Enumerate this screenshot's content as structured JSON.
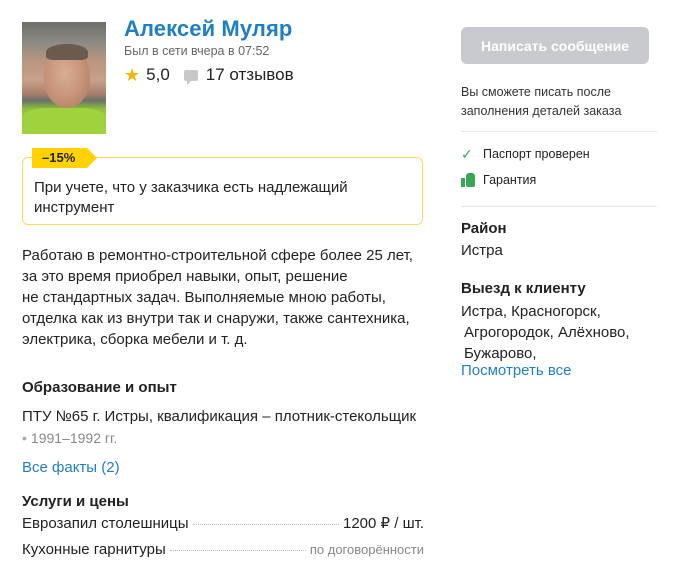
{
  "profile": {
    "name": "Алексей Муляр",
    "last_seen": "Был в сети вчера в 07:52",
    "rating": "5,0",
    "reviews": "17 отзывов"
  },
  "discount": {
    "tag": "–15%",
    "text": "При учете, что у заказчика есть надлежащий инструмент"
  },
  "about": {
    "lines": [
      "Работаю в ремонтно-строительной сфере более 25 лет,",
      "за это время приобрел навыки, опыт, решение",
      "не стандартных задач. Выполняемые мною работы,",
      "отделка как из внутри так и снаружи, также сантехника,",
      "электрика, сборка мебели и т. д."
    ]
  },
  "education": {
    "title": "Образование и опыт",
    "entry": "ПТУ №65 г. Истры, квалификация – плотник-стекольщик",
    "years": "1991–1992 гг.",
    "all_facts_link": "Все факты (2)"
  },
  "services": {
    "title": "Услуги и цены",
    "items": [
      {
        "name": "Еврозапил столешницы",
        "price": "1200 ₽ / шт."
      },
      {
        "name": "Кухонные гарнитуры",
        "price": "по договорённости"
      }
    ]
  },
  "sidebar": {
    "message_button": "Написать сообщение",
    "message_note": "Вы сможете писать после заполнения деталей заказа",
    "badges": [
      "Паспорт проверен",
      "Гарантия"
    ],
    "district_title": "Район",
    "district_value": "Истра",
    "visit_title": "Выезд к клиенту",
    "visit_lines": [
      "Истра,  Красногорск,",
      "Агрогородок,  Алёхново,",
      "Бужарово,"
    ],
    "view_all_link": "Посмотреть все"
  },
  "colors": {
    "accent_link": "#1f7fc4",
    "discount_tag": "#ffd200",
    "discount_border": "#ffd75a",
    "check_green": "#3aa655",
    "star": "#f5b400",
    "disabled_button": "#c8cacd"
  },
  "icons": {
    "star": "star-icon",
    "reviews": "comment-icon",
    "passport": "check-icon",
    "guarantee": "thumbs-up-icon"
  }
}
